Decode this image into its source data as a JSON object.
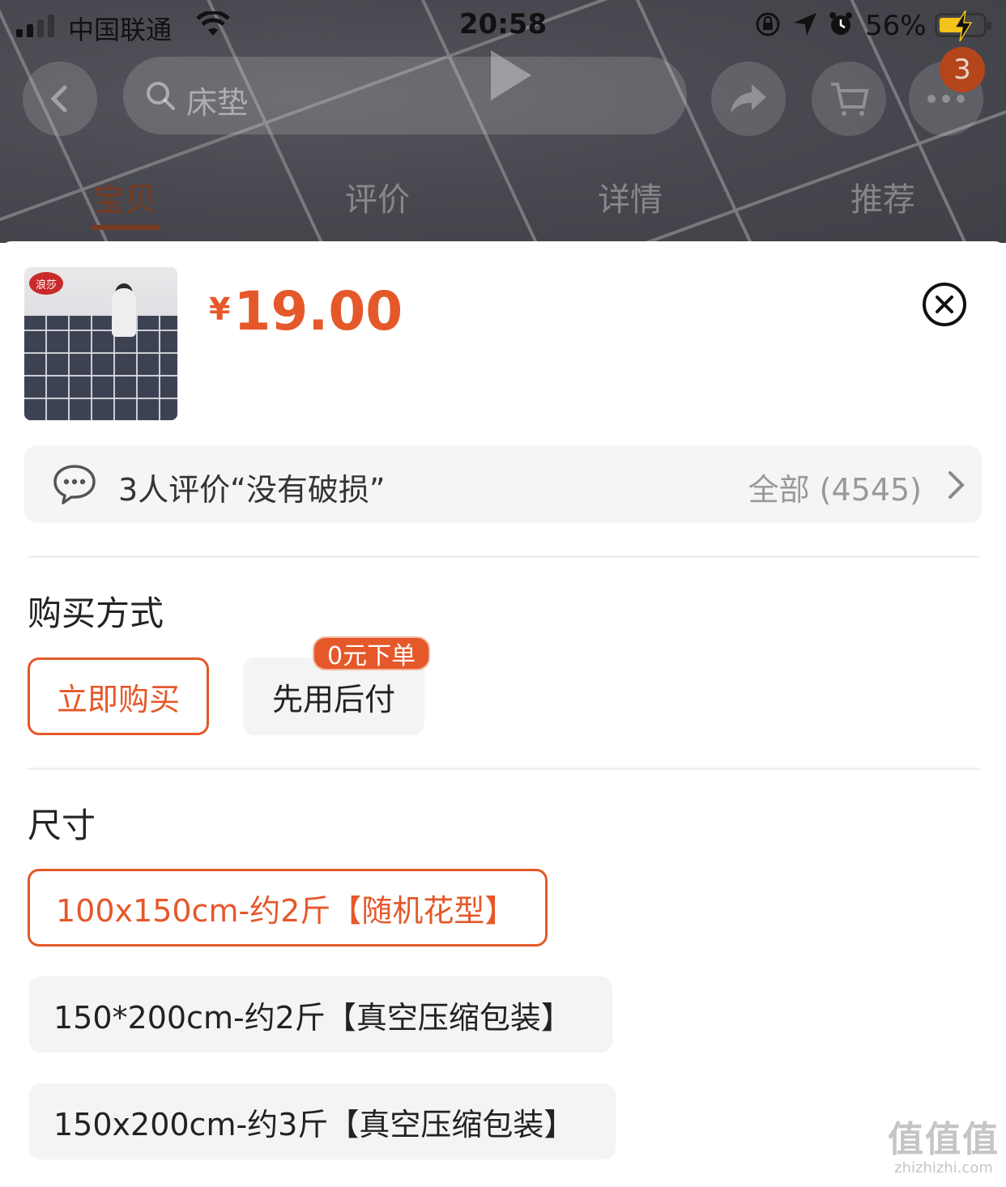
{
  "status_bar": {
    "carrier": "中国联通",
    "time": "20:58",
    "battery_percent": "56%",
    "battery_level": 0.56,
    "battery_fill_color": "#f3c21b",
    "icons": [
      "signal-icon",
      "wifi-icon",
      "orientation-lock-icon",
      "location-arrow-icon",
      "alarm-icon",
      "battery-icon",
      "charging-bolt-icon"
    ]
  },
  "top_nav": {
    "search_placeholder": "床垫",
    "cart_badge_count": "3",
    "icons": [
      "back-icon",
      "search-icon",
      "play-icon",
      "share-icon",
      "cart-icon",
      "more-icon"
    ]
  },
  "tabs": [
    {
      "label": "宝贝",
      "active": true
    },
    {
      "label": "评价",
      "active": false
    },
    {
      "label": "详情",
      "active": false
    },
    {
      "label": "推荐",
      "active": false
    }
  ],
  "product": {
    "currency_symbol": "¥",
    "price": "19.00",
    "thumbnail_logo_text": "浪莎"
  },
  "review_summary": {
    "text": "3人评价“没有破损”",
    "all_label": "全部 (4545)"
  },
  "purchase_method": {
    "title": "购买方式",
    "options": [
      {
        "label": "立即购买",
        "selected": true
      },
      {
        "label": "先用后付",
        "selected": false,
        "tag": "0元下单"
      }
    ]
  },
  "size": {
    "title": "尺寸",
    "options": [
      {
        "label": "100x150cm-约2斤【随机花型】",
        "selected": true
      },
      {
        "label": "150*200cm-约2斤【真空压缩包装】",
        "selected": false
      },
      {
        "label": "150x200cm-约3斤【真空压缩包装】",
        "selected": false
      }
    ]
  },
  "colors": {
    "accent": "#e5582a",
    "badge": "#b5451b",
    "option_bg": "#f4f4f4",
    "review_bg": "#f5f5f5"
  },
  "watermark": {
    "glyphs": "值值值",
    "domain": "zhizhizhi.com"
  }
}
